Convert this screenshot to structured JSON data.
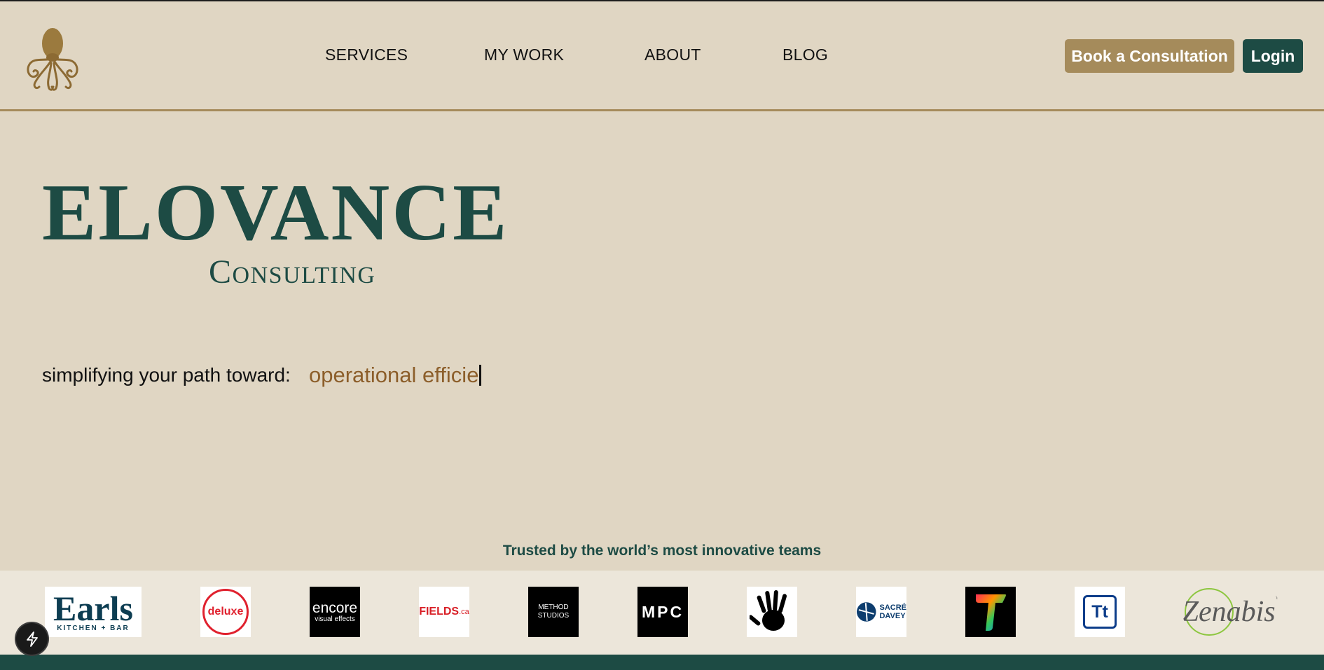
{
  "nav": {
    "items": [
      {
        "label": "SERVICES"
      },
      {
        "label": "MY WORK"
      },
      {
        "label": "ABOUT"
      },
      {
        "label": "BLOG"
      }
    ],
    "book_label": "Book a Consultation",
    "login_label": "Login"
  },
  "hero": {
    "title": "ELOVANCE",
    "subtitle": "Consulting",
    "tagline_prefix": "simplifying your path toward:",
    "typed_text": "operational efficie"
  },
  "clients": {
    "heading": "Trusted by the world’s most innovative teams",
    "logos": [
      {
        "name": "Earls",
        "text": "Earls",
        "subtext": "KITCHEN + BAR"
      },
      {
        "name": "deluxe",
        "text": "deluxe"
      },
      {
        "name": "encore",
        "text": "encore",
        "subtext": "visual effects"
      },
      {
        "name": "FIELDS",
        "text": "FIELDS",
        "subtext": ".ca"
      },
      {
        "name": "Method Studios",
        "text": "METHOD",
        "subtext": "STUDIOS"
      },
      {
        "name": "MPC",
        "text": "MPC"
      },
      {
        "name": "handprint",
        "text": ""
      },
      {
        "name": "Sacré Davey",
        "text": "SACRÉ",
        "subtext": "DAVEY"
      },
      {
        "name": "T",
        "text": ""
      },
      {
        "name": "Tt",
        "text": "Tt"
      },
      {
        "name": "Zenabis",
        "text": "Zenabis",
        "subtext": "™"
      }
    ]
  },
  "colors": {
    "background": "#e0d6c3",
    "brand_green": "#1d4b44",
    "gold": "#a58b5b",
    "typed_text": "#8c5e2a"
  },
  "icons": {
    "logo": "octopus-icon",
    "floating_button": "lightning-icon"
  }
}
